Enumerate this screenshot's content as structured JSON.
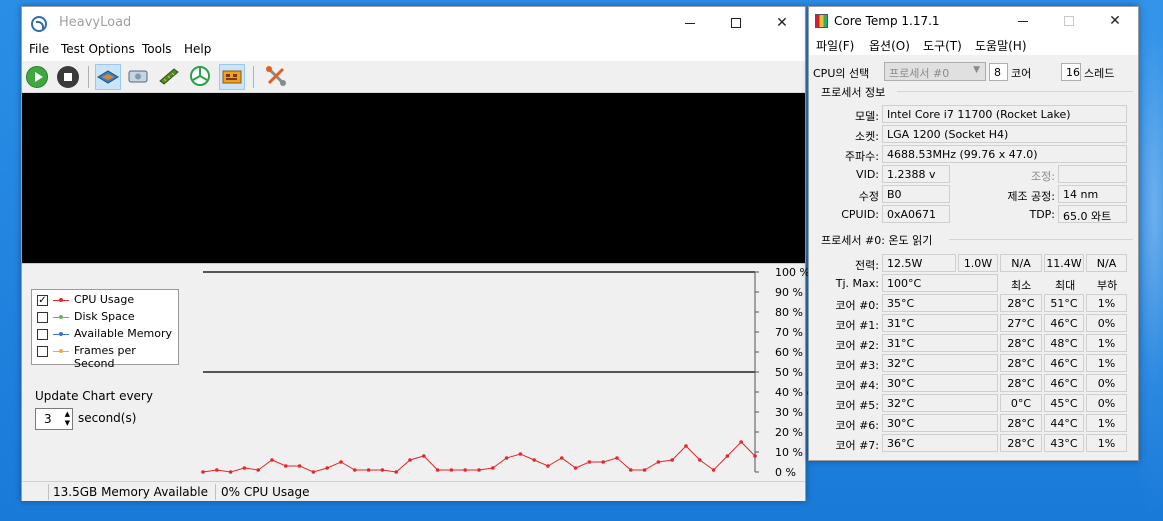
{
  "heavyload": {
    "title": "HeavyLoad",
    "menu": [
      "File",
      "Test Options",
      "Tools",
      "Help"
    ],
    "toolbar_icons": [
      "start-icon",
      "stop-icon",
      "cpu-icon",
      "disk-icon",
      "memory-icon",
      "gpu-icon",
      "fps-icon",
      "settings-icon"
    ],
    "legend": [
      {
        "label": "CPU Usage",
        "checked": true,
        "color": "#e8262a"
      },
      {
        "label": "Disk Space",
        "checked": false,
        "color": "#5fb85f"
      },
      {
        "label": "Available Memory",
        "checked": false,
        "color": "#3a73c8"
      },
      {
        "label": "Frames per Second",
        "checked": false,
        "color": "#f2a93b"
      }
    ],
    "update_label": "Update Chart every",
    "update_value": "3",
    "update_unit": "second(s)",
    "status": {
      "memory": "13.5GB Memory Available",
      "cpu": "0% CPU Usage"
    }
  },
  "chart_data": {
    "type": "line",
    "ylabel": "CPU Usage",
    "ylim": [
      0,
      100
    ],
    "yticks": [
      "100 %",
      "90 %",
      "80 %",
      "70 %",
      "60 %",
      "50 %",
      "40 %",
      "30 %",
      "20 %",
      "10 %",
      "0 %"
    ],
    "grid": false,
    "series": [
      {
        "name": "CPU Usage",
        "color": "#e8262a",
        "values": [
          0,
          1,
          0,
          2,
          1,
          6,
          3,
          3,
          0,
          2,
          5,
          1,
          1,
          1,
          0,
          6,
          8,
          1,
          1,
          1,
          1,
          2,
          7,
          9,
          6,
          3,
          7,
          2,
          5,
          5,
          7,
          1,
          1,
          5,
          6,
          13,
          6,
          1,
          8,
          15,
          8
        ]
      }
    ]
  },
  "coretemp": {
    "title": "Core Temp 1.17.1",
    "menu": [
      "파일(F)",
      "옵션(O)",
      "도구(T)",
      "도움말(H)"
    ],
    "cpu_select_label": "CPU의 선택",
    "processor": "프로세서 #0",
    "cores": "8",
    "cores_label": "코어",
    "threads": "16",
    "threads_label": "스레드",
    "info_group": "프로세서 정보",
    "model_label": "모델:",
    "model": "Intel Core i7 11700 (Rocket Lake)",
    "socket_label": "소켓:",
    "socket": "LGA 1200 (Socket H4)",
    "freq_label": "주파수:",
    "freq": "4688.53MHz (99.76 x 47.0)",
    "vid_label": "VID:",
    "vid": "1.2388 v",
    "adjust_label": "조정:",
    "adjust": "",
    "rev_label": "수정",
    "rev": "B0",
    "lith_label": "제조 공정:",
    "lith": "14 nm",
    "cpuid_label": "CPUID:",
    "cpuid": "0xA0671",
    "tdp_label": "TDP:",
    "tdp": "65.0 와트",
    "temp_group": "프로세서 #0: 온도 읽기",
    "power_label": "전력:",
    "power": [
      "12.5W",
      "1.0W",
      "N/A",
      "11.4W",
      "N/A"
    ],
    "tjmax_label": "Tj. Max:",
    "tjmax": "100°C",
    "col_min": "최소",
    "col_max": "최대",
    "col_load": "부하",
    "cores_rows": [
      {
        "label": "코어 #0:",
        "temp": "35°C",
        "min": "28°C",
        "max": "51°C",
        "load": "1%"
      },
      {
        "label": "코어 #1:",
        "temp": "31°C",
        "min": "27°C",
        "max": "46°C",
        "load": "0%"
      },
      {
        "label": "코어 #2:",
        "temp": "31°C",
        "min": "28°C",
        "max": "48°C",
        "load": "1%"
      },
      {
        "label": "코어 #3:",
        "temp": "32°C",
        "min": "28°C",
        "max": "46°C",
        "load": "1%"
      },
      {
        "label": "코어 #4:",
        "temp": "30°C",
        "min": "28°C",
        "max": "46°C",
        "load": "0%"
      },
      {
        "label": "코어 #5:",
        "temp": "32°C",
        "min": "0°C",
        "max": "45°C",
        "load": "0%"
      },
      {
        "label": "코어 #6:",
        "temp": "30°C",
        "min": "28°C",
        "max": "44°C",
        "load": "1%"
      },
      {
        "label": "코어 #7:",
        "temp": "36°C",
        "min": "28°C",
        "max": "43°C",
        "load": "1%"
      }
    ]
  }
}
